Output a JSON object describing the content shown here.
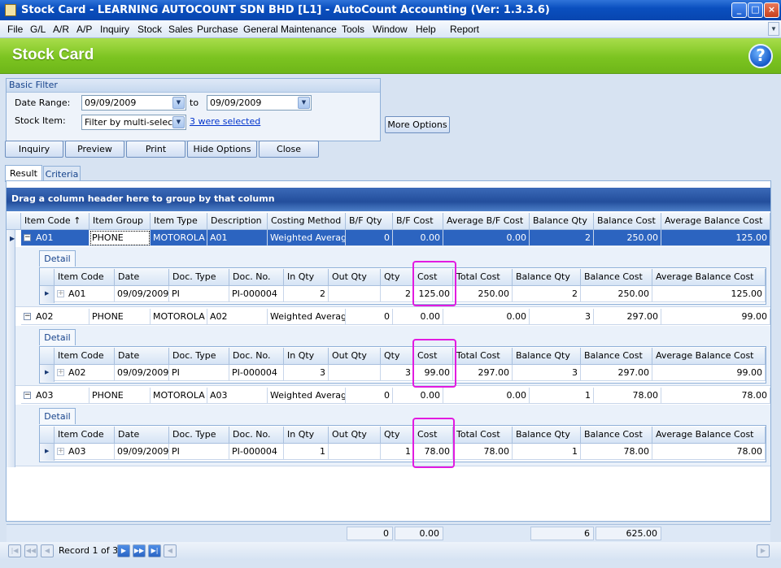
{
  "window": {
    "title": "Stock Card - LEARNING AUTOCOUNT SDN BHD [L1] - AutoCount Accounting (Ver: 1.3.3.6)",
    "min": "_",
    "max": "□",
    "close": "×"
  },
  "menu": [
    "File",
    "G/L",
    "A/R",
    "A/P",
    "Inquiry",
    "Stock",
    "Sales",
    "Purchase",
    "General Maintenance",
    "Tools",
    "Window",
    "Help",
    "Report"
  ],
  "header": {
    "title": "Stock Card",
    "help": "?"
  },
  "filter": {
    "title": "Basic Filter",
    "date_range_label": "Date Range:",
    "date_from": "09/09/2009",
    "to_label": "to",
    "date_to": "09/09/2009",
    "stock_item_label": "Stock Item:",
    "stock_item_mode": "Filter by multi-select",
    "selected_link": "3 were selected",
    "more_options": "More Options"
  },
  "toolbar": {
    "inquiry": "Inquiry",
    "preview": "Preview",
    "print": "Print",
    "hide_options": "Hide Options",
    "close": "Close"
  },
  "tabs": {
    "result": "Result",
    "criteria": "Criteria"
  },
  "grid": {
    "group_hint": "Drag a column header here to group by that column",
    "columns": [
      "Item Code",
      "Item Group",
      "Item Type",
      "Description",
      "Costing Method",
      "B/F Qty",
      "B/F Cost",
      "Average B/F Cost",
      "Balance Qty",
      "Balance Cost",
      "Average Balance Cost"
    ],
    "sort_icon": "↑",
    "rows": [
      {
        "item_code": "A01",
        "item_group": "PHONE",
        "item_type": "MOTOROLA",
        "description": "A01",
        "costing_method": "Weighted Average",
        "bf_qty": "0",
        "bf_cost": "0.00",
        "avg_bf_cost": "0.00",
        "balance_qty": "2",
        "balance_cost": "250.00",
        "avg_balance_cost": "125.00",
        "detail": {
          "tab": "Detail",
          "row": {
            "item_code": "A01",
            "date": "09/09/2009",
            "doc_type": "PI",
            "doc_no": "PI-000004",
            "in_qty": "2",
            "out_qty": "",
            "qty": "2",
            "cost": "125.00",
            "total_cost": "250.00",
            "balance_qty": "2",
            "balance_cost": "250.00",
            "avg_balance_cost": "125.00"
          }
        }
      },
      {
        "item_code": "A02",
        "item_group": "PHONE",
        "item_type": "MOTOROLA",
        "description": "A02",
        "costing_method": "Weighted Average",
        "bf_qty": "0",
        "bf_cost": "0.00",
        "avg_bf_cost": "0.00",
        "balance_qty": "3",
        "balance_cost": "297.00",
        "avg_balance_cost": "99.00",
        "detail": {
          "tab": "Detail",
          "row": {
            "item_code": "A02",
            "date": "09/09/2009",
            "doc_type": "PI",
            "doc_no": "PI-000004",
            "in_qty": "3",
            "out_qty": "",
            "qty": "3",
            "cost": "99.00",
            "total_cost": "297.00",
            "balance_qty": "3",
            "balance_cost": "297.00",
            "avg_balance_cost": "99.00"
          }
        }
      },
      {
        "item_code": "A03",
        "item_group": "PHONE",
        "item_type": "MOTOROLA",
        "description": "A03",
        "costing_method": "Weighted Average",
        "bf_qty": "0",
        "bf_cost": "0.00",
        "avg_bf_cost": "0.00",
        "balance_qty": "1",
        "balance_cost": "78.00",
        "avg_balance_cost": "78.00",
        "detail": {
          "tab": "Detail",
          "row": {
            "item_code": "A03",
            "date": "09/09/2009",
            "doc_type": "PI",
            "doc_no": "PI-000004",
            "in_qty": "1",
            "out_qty": "",
            "qty": "1",
            "cost": "78.00",
            "total_cost": "78.00",
            "balance_qty": "1",
            "balance_cost": "78.00",
            "avg_balance_cost": "78.00"
          }
        }
      }
    ],
    "detail_columns": [
      "Item Code",
      "Date",
      "Doc. Type",
      "Doc. No.",
      "In Qty",
      "Out Qty",
      "Qty",
      "Cost",
      "Total Cost",
      "Balance Qty",
      "Balance Cost",
      "Average Balance Cost"
    ],
    "footer": {
      "bf_qty": "0",
      "bf_cost": "0.00",
      "balance_qty": "6",
      "balance_cost": "625.00"
    }
  },
  "navigator": {
    "record_text": "Record 1 of 3"
  },
  "colors": {
    "selection": "#2c64c0",
    "highlight": "#e21be0",
    "header_green": "#7cc421"
  }
}
